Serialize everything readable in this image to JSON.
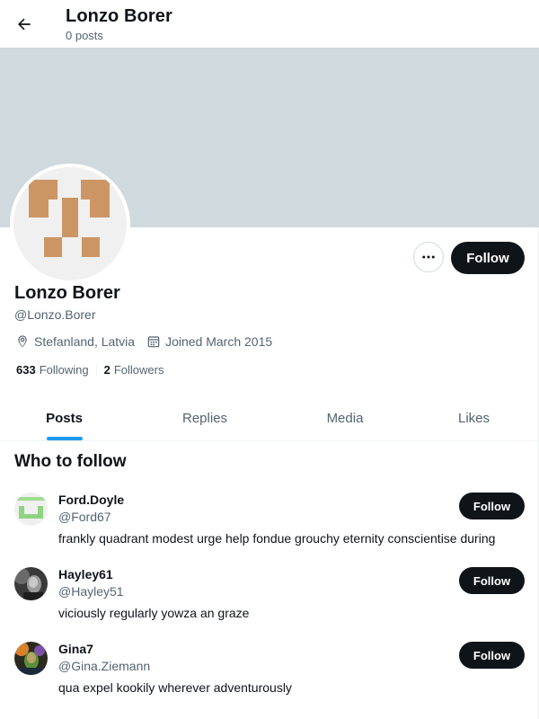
{
  "header": {
    "title": "Lonzo Borer",
    "subtitle": "0 posts",
    "back_icon": "arrow-left-icon"
  },
  "colors": {
    "banner": "#cfd9de",
    "accent": "#1d9bf0",
    "button": "#0f1419",
    "avatar_block": "#cc9664"
  },
  "profile": {
    "name": "Lonzo Borer",
    "handle": "@Lonzo.Borer",
    "location": "Stefanland, Latvia",
    "joined": "Joined March 2015",
    "following_count": "633",
    "following_label": "Following",
    "followers_count": "2",
    "followers_label": "Followers",
    "follow_label": "Follow",
    "more_icon": "more-horizontal-icon"
  },
  "tabs": [
    {
      "label": "Posts",
      "active": true
    },
    {
      "label": "Replies",
      "active": false
    },
    {
      "label": "Media",
      "active": false
    },
    {
      "label": "Likes",
      "active": false
    }
  ],
  "who_to_follow": {
    "title": "Who to follow",
    "users": [
      {
        "name": "Ford.Doyle",
        "handle": "@Ford67",
        "bio": "frankly quadrant modest urge help fondue grouchy eternity conscientise during",
        "follow_label": "Follow"
      },
      {
        "name": "Hayley61",
        "handle": "@Hayley51",
        "bio": "viciously regularly yowza an graze",
        "follow_label": "Follow"
      },
      {
        "name": "Gina7",
        "handle": "@Gina.Ziemann",
        "bio": "qua expel kookily wherever adventurously",
        "follow_label": "Follow"
      }
    ]
  }
}
